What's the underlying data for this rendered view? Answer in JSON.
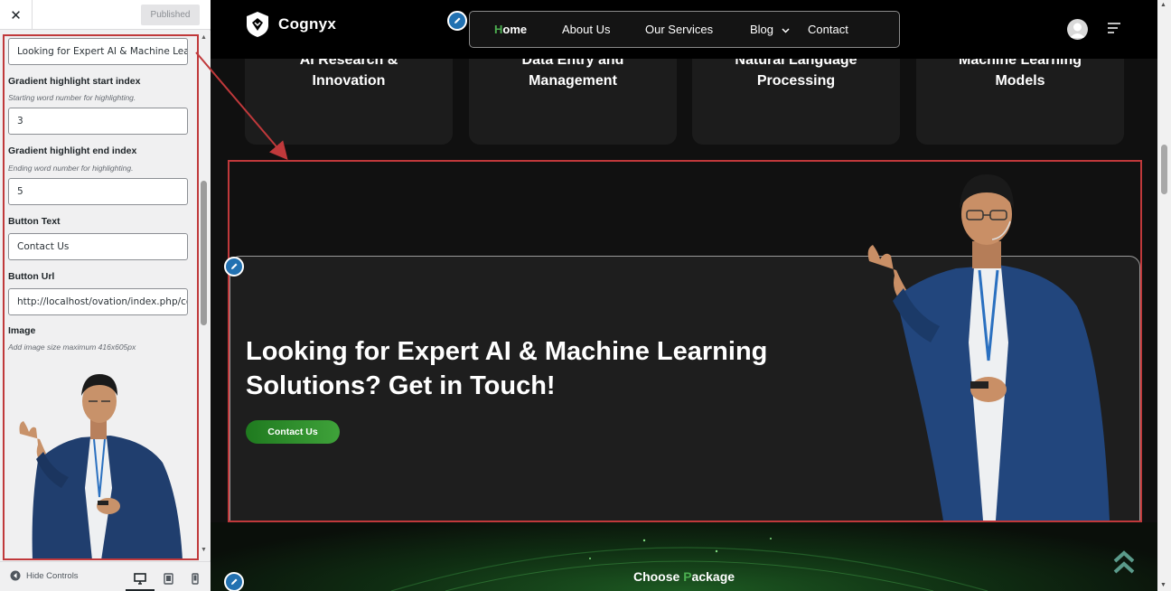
{
  "sidebar": {
    "close_icon": "close-icon",
    "publish_status": "Published",
    "fields": {
      "title_value": "Looking for Expert AI & Machine Learn",
      "gradient_start": {
        "label": "Gradient highlight start index",
        "description": "Starting word number for highlighting.",
        "value": "3"
      },
      "gradient_end": {
        "label": "Gradient highlight end index",
        "description": "Ending word number for highlighting.",
        "value": "5"
      },
      "button_text": {
        "label": "Button Text",
        "value": "Contact Us"
      },
      "button_url": {
        "label": "Button Url",
        "value": "http://localhost/ovation/index.php/co"
      },
      "image": {
        "label": "Image",
        "description": "Add image size maximum 416x605px"
      }
    },
    "footer": {
      "hide_controls": "Hide Controls",
      "devices": [
        "desktop",
        "tablet",
        "mobile"
      ],
      "active_device": "desktop"
    }
  },
  "preview": {
    "brand": "Cognyx",
    "menu": {
      "home": {
        "hl": "H",
        "rest": "ome"
      },
      "about": "About Us",
      "services": "Our Services",
      "blog": "Blog",
      "contact": "Contact"
    },
    "services": [
      {
        "line1": "AI Research &",
        "line2": "Innovation"
      },
      {
        "line1": "Data Entry and",
        "line2": "Management"
      },
      {
        "line1": "Natural Language",
        "line2": "Processing"
      },
      {
        "line1": "Machine Learning",
        "line2": "Models"
      }
    ],
    "cta": {
      "title_line1": "Looking for Expert AI & Machine Learning",
      "title_line2": "Solutions? Get in Touch!",
      "button": "Contact Us"
    },
    "package": {
      "label_a": "Choose ",
      "label_hl": "P",
      "label_b": "ackage"
    }
  },
  "colors": {
    "accent_green": "#4caf50",
    "highlight_red": "#c0393b",
    "edit_blue": "#2271b1"
  }
}
